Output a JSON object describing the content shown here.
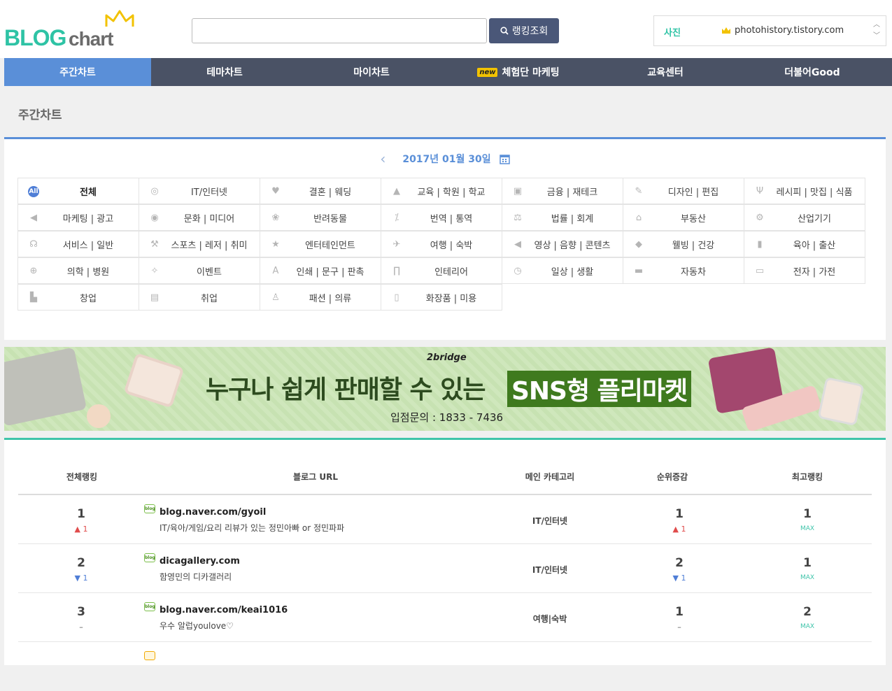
{
  "header": {
    "logo_blog": "BLOG",
    "logo_chart": "chart",
    "search_placeholder": "",
    "search_button": "랭킹조회",
    "ticker": {
      "category": "사진",
      "url": "photohistory.tistory.com"
    }
  },
  "nav": {
    "items": [
      {
        "label": "주간차트",
        "active": true
      },
      {
        "label": "테마차트"
      },
      {
        "label": "마이차트"
      },
      {
        "label": "체험단 마케팅",
        "badge": "new"
      },
      {
        "label": "교육센터"
      },
      {
        "label": "더불어Good"
      }
    ]
  },
  "page_title": "주간차트",
  "date": "2017년 01월 30일",
  "categories": [
    [
      {
        "label": "전체",
        "icon": "all-icon",
        "glyph": "All"
      },
      {
        "label": "IT/인터넷",
        "icon": "globe-icon",
        "glyph": "◎"
      },
      {
        "label": "결혼 | 웨딩",
        "icon": "heart-icon",
        "glyph": "♥"
      },
      {
        "label": "교육 | 학원 | 학교",
        "icon": "graduation-cap-icon",
        "glyph": "▲"
      },
      {
        "label": "금융 | 재테크",
        "icon": "money-icon",
        "glyph": "▣"
      },
      {
        "label": "디자인 | 편집",
        "icon": "pencil-icon",
        "glyph": "✎"
      },
      {
        "label": "레시피 | 맛집 | 식품",
        "icon": "fork-knife-icon",
        "glyph": "Ψ"
      }
    ],
    [
      {
        "label": "마케팅 | 광고",
        "icon": "megaphone-icon",
        "glyph": "◀"
      },
      {
        "label": "문화 | 미디어",
        "icon": "disc-icon",
        "glyph": "◉"
      },
      {
        "label": "반려동물",
        "icon": "paw-icon",
        "glyph": "❀"
      },
      {
        "label": "번역 | 통역",
        "icon": "translate-icon",
        "glyph": "⁒"
      },
      {
        "label": "법률 | 회계",
        "icon": "gavel-icon",
        "glyph": "⚖"
      },
      {
        "label": "부동산",
        "icon": "home-icon",
        "glyph": "⌂"
      },
      {
        "label": "산업기기",
        "icon": "gear-icon",
        "glyph": "⚙"
      }
    ],
    [
      {
        "label": "서비스 | 일반",
        "icon": "headset-icon",
        "glyph": "☊"
      },
      {
        "label": "스포츠 | 레저 | 취미",
        "icon": "dumbbell-icon",
        "glyph": "⚒"
      },
      {
        "label": "엔터테인먼트",
        "icon": "star-icon",
        "glyph": "★"
      },
      {
        "label": "여행 | 숙박",
        "icon": "airplane-icon",
        "glyph": "✈"
      },
      {
        "label": "영상 | 음향 | 콘텐츠",
        "icon": "speaker-icon",
        "glyph": "◀"
      },
      {
        "label": "웰빙 | 건강",
        "icon": "pill-icon",
        "glyph": "◆"
      },
      {
        "label": "육아 | 출산",
        "icon": "baby-bottle-icon",
        "glyph": "▮"
      }
    ],
    [
      {
        "label": "의학 | 병원",
        "icon": "plus-circle-icon",
        "glyph": "⊕"
      },
      {
        "label": "이벤트",
        "icon": "party-icon",
        "glyph": "✧"
      },
      {
        "label": "인쇄 | 문구 | 판촉",
        "icon": "font-icon",
        "glyph": "A"
      },
      {
        "label": "인테리어",
        "icon": "door-icon",
        "glyph": "∏"
      },
      {
        "label": "일상 | 생활",
        "icon": "clock-icon",
        "glyph": "◷"
      },
      {
        "label": "자동차",
        "icon": "car-icon",
        "glyph": "▬"
      },
      {
        "label": "전자 | 가전",
        "icon": "monitor-icon",
        "glyph": "▭"
      }
    ],
    [
      {
        "label": "창업",
        "icon": "shop-icon",
        "glyph": "▙"
      },
      {
        "label": "취업",
        "icon": "briefcase-icon",
        "glyph": "▤"
      },
      {
        "label": "패션 | 의류",
        "icon": "shirt-icon",
        "glyph": "♙"
      },
      {
        "label": "화장품 | 미용",
        "icon": "cosmetics-icon",
        "glyph": "▯"
      }
    ]
  ],
  "banner": {
    "brand": "2bridge",
    "headline": "누구나 쉽게 판매할 수 있는",
    "highlight": "SNS형 플리마켓",
    "contact": "입점문의 : 1833 - 7436"
  },
  "table": {
    "headers": [
      "전체랭킹",
      "블로그 URL",
      "메인 카테고리",
      "순위증감",
      "최고랭킹"
    ],
    "max_label": "MAX",
    "rows": [
      {
        "rank": "1",
        "rank_delta": "▲ 1",
        "rank_dir": "up",
        "url": "blog.naver.com/gyoil",
        "desc": "IT/육아/게임/요리 리뷰가 있는 정민아빠 or 정민파파",
        "category": "IT/인터넷",
        "change": "1",
        "change_delta": "▲ 1",
        "change_dir": "up",
        "best": "1"
      },
      {
        "rank": "2",
        "rank_delta": "▼ 1",
        "rank_dir": "down",
        "url": "dicagallery.com",
        "desc": "함영민의 디카갤러리",
        "category": "IT/인터넷",
        "change": "2",
        "change_delta": "▼ 1",
        "change_dir": "down",
        "best": "1"
      },
      {
        "rank": "3",
        "rank_delta": "–",
        "rank_dir": "same",
        "url": "blog.naver.com/keai1016",
        "desc": "우수 알럽youlove♡",
        "category": "여행|숙박",
        "change": "1",
        "change_delta": "–",
        "change_dir": "same",
        "best": "2"
      }
    ]
  },
  "colors": {
    "accent_blue": "#5a8fd8",
    "accent_green": "#3fc4aa",
    "nav_bg": "#4a5265",
    "up": "#e04b4b",
    "down": "#4f7ed6"
  }
}
